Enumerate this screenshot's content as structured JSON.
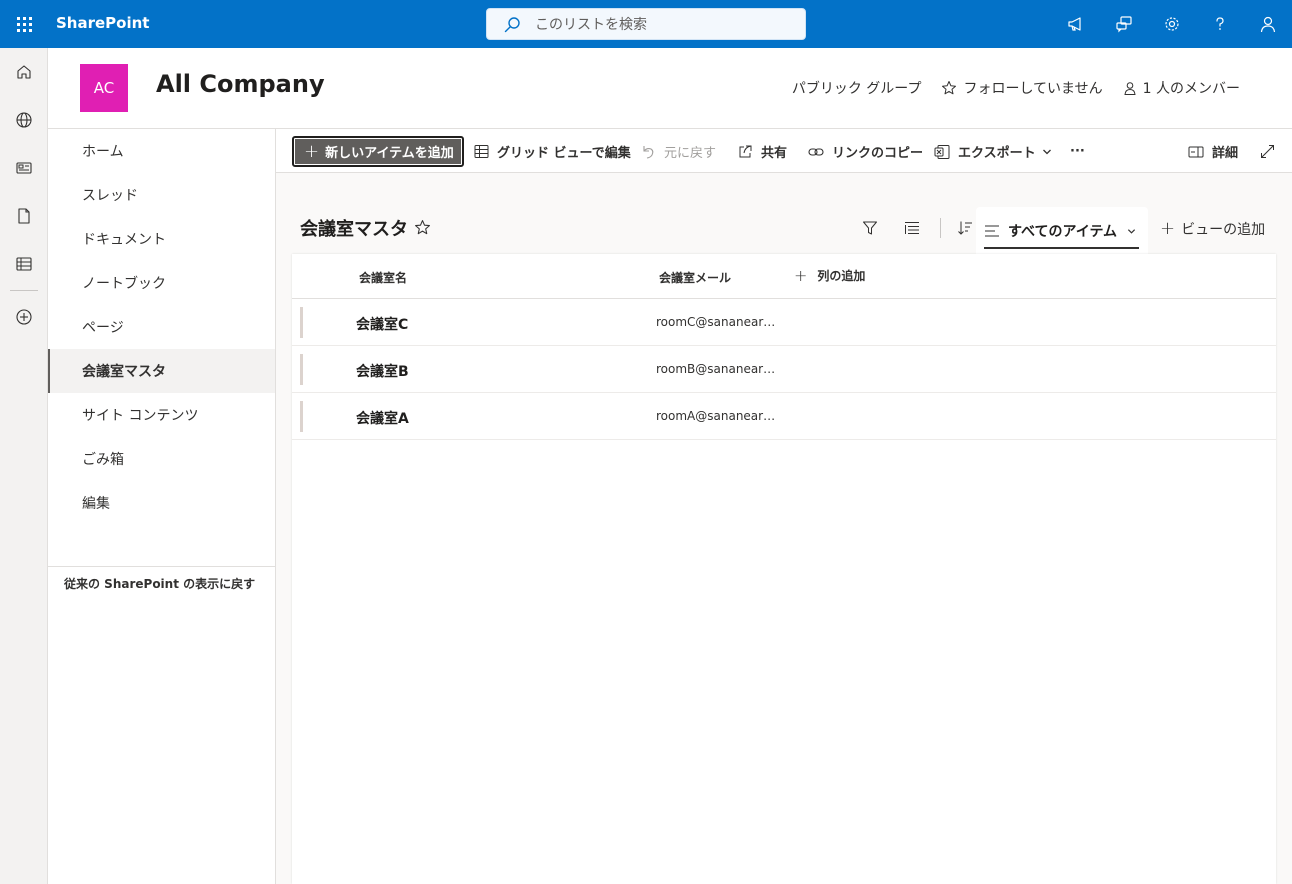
{
  "suite": {
    "app_name": "SharePoint",
    "search_placeholder": "このリストを検索"
  },
  "site": {
    "logo_initials": "AC",
    "logo_color": "#e01fb3",
    "title": "All Company",
    "group_type": "パブリック グループ",
    "follow_label": "フォローしていません",
    "members_label": "1 人のメンバー"
  },
  "nav": {
    "items": [
      {
        "label": "ホーム",
        "active": false
      },
      {
        "label": "スレッド",
        "active": false
      },
      {
        "label": "ドキュメント",
        "active": false
      },
      {
        "label": "ノートブック",
        "active": false
      },
      {
        "label": "ページ",
        "active": false
      },
      {
        "label": "会議室マスタ",
        "active": true
      },
      {
        "label": "サイト コンテンツ",
        "active": false
      },
      {
        "label": "ごみ箱",
        "active": false
      },
      {
        "label": "編集",
        "active": false
      }
    ],
    "classic_link": "従来の SharePoint の表示に戻す"
  },
  "commands": {
    "new_item": "新しいアイテムを追加",
    "grid_edit": "グリッド ビューで編集",
    "undo": "元に戻す",
    "share": "共有",
    "copy_link": "リンクのコピー",
    "export": "エクスポート",
    "more": "···",
    "details": "詳細"
  },
  "list": {
    "title": "会議室マスタ",
    "view_name": "すべてのアイテム",
    "add_view": "ビューの追加",
    "columns": [
      "会議室名",
      "会議室メール"
    ],
    "add_column": "列の追加",
    "rows": [
      {
        "name": "会議室C",
        "email": "roomC@sananear…"
      },
      {
        "name": "会議室B",
        "email": "roomB@sananear…"
      },
      {
        "name": "会議室A",
        "email": "roomA@sananear…"
      }
    ]
  },
  "colors": {
    "suite_bar": "#0372c8",
    "primary_button": "#605e5c"
  }
}
